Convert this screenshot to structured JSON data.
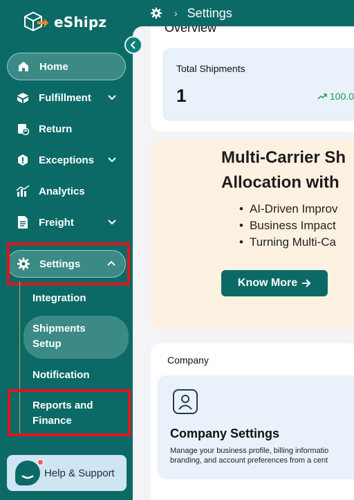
{
  "app": {
    "brand": "eShipz"
  },
  "topbar": {
    "breadcrumb_sep": "›",
    "title": "Settings"
  },
  "sidebar": {
    "items": [
      {
        "label": "Home"
      },
      {
        "label": "Fulfillment"
      },
      {
        "label": "Return"
      },
      {
        "label": "Exceptions"
      },
      {
        "label": "Analytics"
      },
      {
        "label": "Freight"
      },
      {
        "label": "Settings"
      }
    ],
    "settings_sub": [
      {
        "label": "Integration"
      },
      {
        "label": "Shipments Setup"
      },
      {
        "label": "Notification"
      },
      {
        "label": "Reports and Finance"
      }
    ],
    "help": {
      "label": "Help & Support"
    }
  },
  "overview": {
    "title": "Overview",
    "total_shipments_label": "Total Shipments",
    "total_shipments_value": "1",
    "trend": "100.0"
  },
  "banner": {
    "title_line1": "Multi-Carrier Sh",
    "title_line2": "Allocation with",
    "bullets": [
      "AI-Driven Improv",
      "Business Impact",
      "Turning Multi-Ca"
    ],
    "button_label": "Know More"
  },
  "company": {
    "section_label": "Company",
    "card_title": "Company Settings",
    "card_desc_1": "Manage your business profile, billing informatio",
    "card_desc_2": "branding, and account preferences from a cent"
  },
  "colors": {
    "brand": "#0b6a66",
    "highlight": "#e3141b",
    "trend": "#1a9c55"
  }
}
